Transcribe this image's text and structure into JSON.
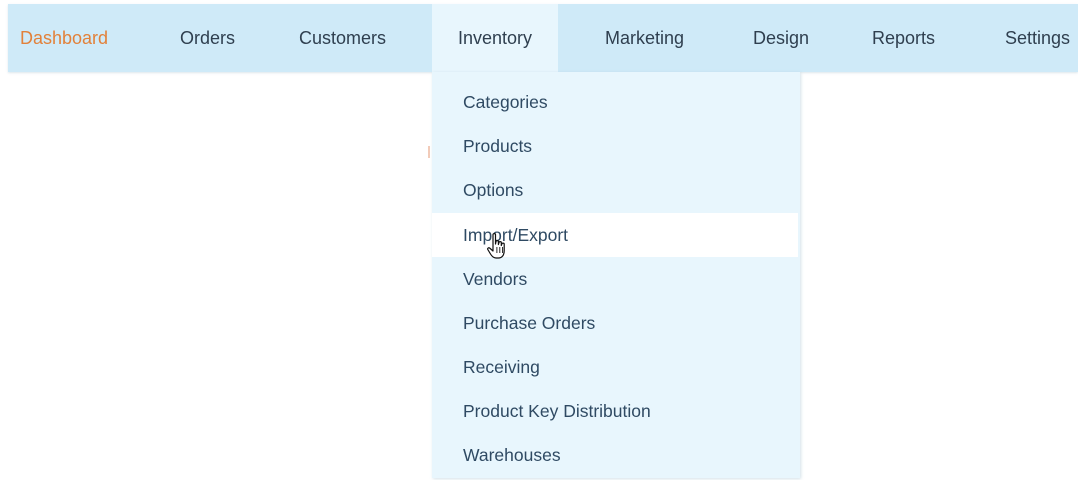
{
  "nav": {
    "items": [
      {
        "label": "Dashboard"
      },
      {
        "label": "Orders"
      },
      {
        "label": "Customers"
      },
      {
        "label": "Inventory"
      },
      {
        "label": "Marketing"
      },
      {
        "label": "Design"
      },
      {
        "label": "Reports"
      },
      {
        "label": "Settings"
      }
    ],
    "active_color": "#e2813a",
    "background_color": "#cfeaf8"
  },
  "inventory_menu": {
    "items": [
      {
        "label": "Categories"
      },
      {
        "label": "Products"
      },
      {
        "label": "Options"
      },
      {
        "label": "Import/Export",
        "hovered": true
      },
      {
        "label": "Vendors"
      },
      {
        "label": "Purchase Orders"
      },
      {
        "label": "Receiving"
      },
      {
        "label": "Product Key Distribution"
      },
      {
        "label": "Warehouses"
      }
    ],
    "background_color": "#e8f6fd"
  },
  "cursor": {
    "icon": "hand-pointer-icon"
  }
}
